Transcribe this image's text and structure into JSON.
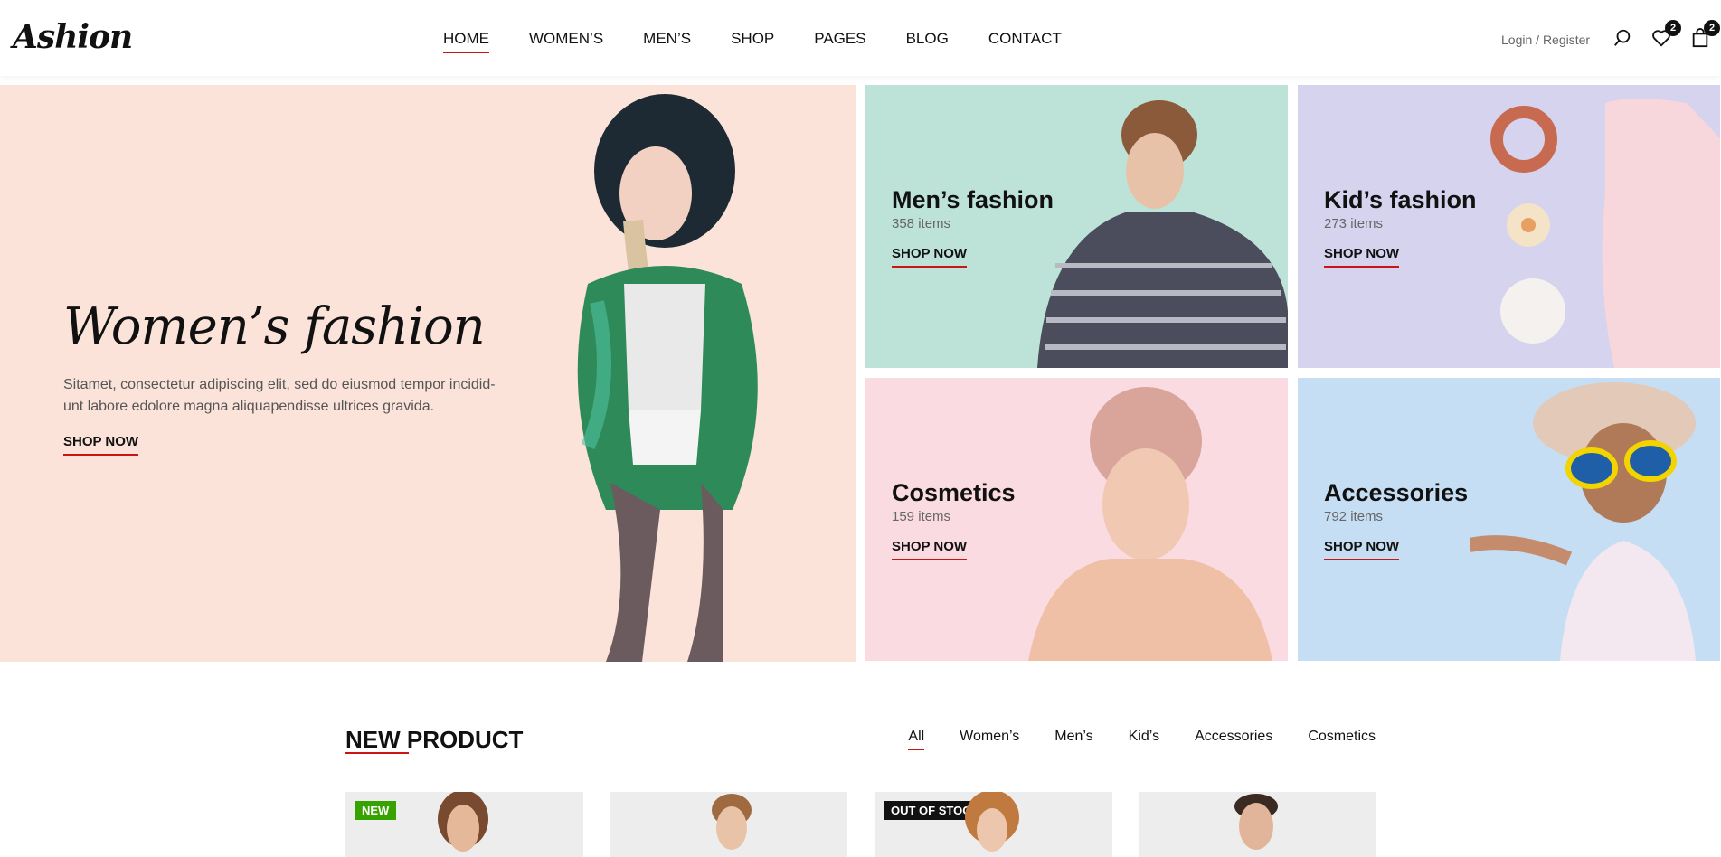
{
  "brand": {
    "logo": "Ashion"
  },
  "nav": {
    "items": [
      "HOME",
      "WOMEN’S",
      "MEN’S",
      "SHOP",
      "PAGES",
      "BLOG",
      "CONTACT"
    ],
    "active": "HOME"
  },
  "header": {
    "login": "Login",
    "separator": " / ",
    "register": "Register",
    "wishlist_count": "2",
    "cart_count": "2"
  },
  "hero": {
    "title": "Women’s fashion",
    "description": "Sitamet, consectetur adipiscing elit, sed do eiusmod tempor incidid-unt labore edolore magna aliquapendisse ultrices gravida.",
    "cta": "SHOP NOW"
  },
  "categories": [
    {
      "title": "Men’s fashion",
      "count": "358 items",
      "cta": "SHOP NOW",
      "bg": "#bde3d9"
    },
    {
      "title": "Kid’s fashion",
      "count": "273 items",
      "cta": "SHOP NOW",
      "bg": "#d5d3ee"
    },
    {
      "title": "Cosmetics",
      "count": "159 items",
      "cta": "SHOP NOW",
      "bg": "#fadbe1"
    },
    {
      "title": "Accessories",
      "count": "792 items",
      "cta": "SHOP NOW",
      "bg": "#c5def3"
    }
  ],
  "new_product": {
    "title": "NEW PRODUCT",
    "filters": [
      "All",
      "Women’s",
      "Men’s",
      "Kid’s",
      "Accessories",
      "Cosmetics"
    ],
    "active_filter": "All",
    "cards": [
      {
        "tag": "NEW",
        "tag_type": "new"
      },
      {
        "tag": "",
        "tag_type": ""
      },
      {
        "tag": "OUT OF STOCK",
        "tag_type": "oos"
      },
      {
        "tag": "",
        "tag_type": ""
      }
    ]
  },
  "colors": {
    "accent": "#ca1515",
    "hero_bg": "#fbe3da",
    "new_tag": "#36a300"
  },
  "icons": [
    "search-icon",
    "heart-icon",
    "shopping-bag-icon"
  ]
}
